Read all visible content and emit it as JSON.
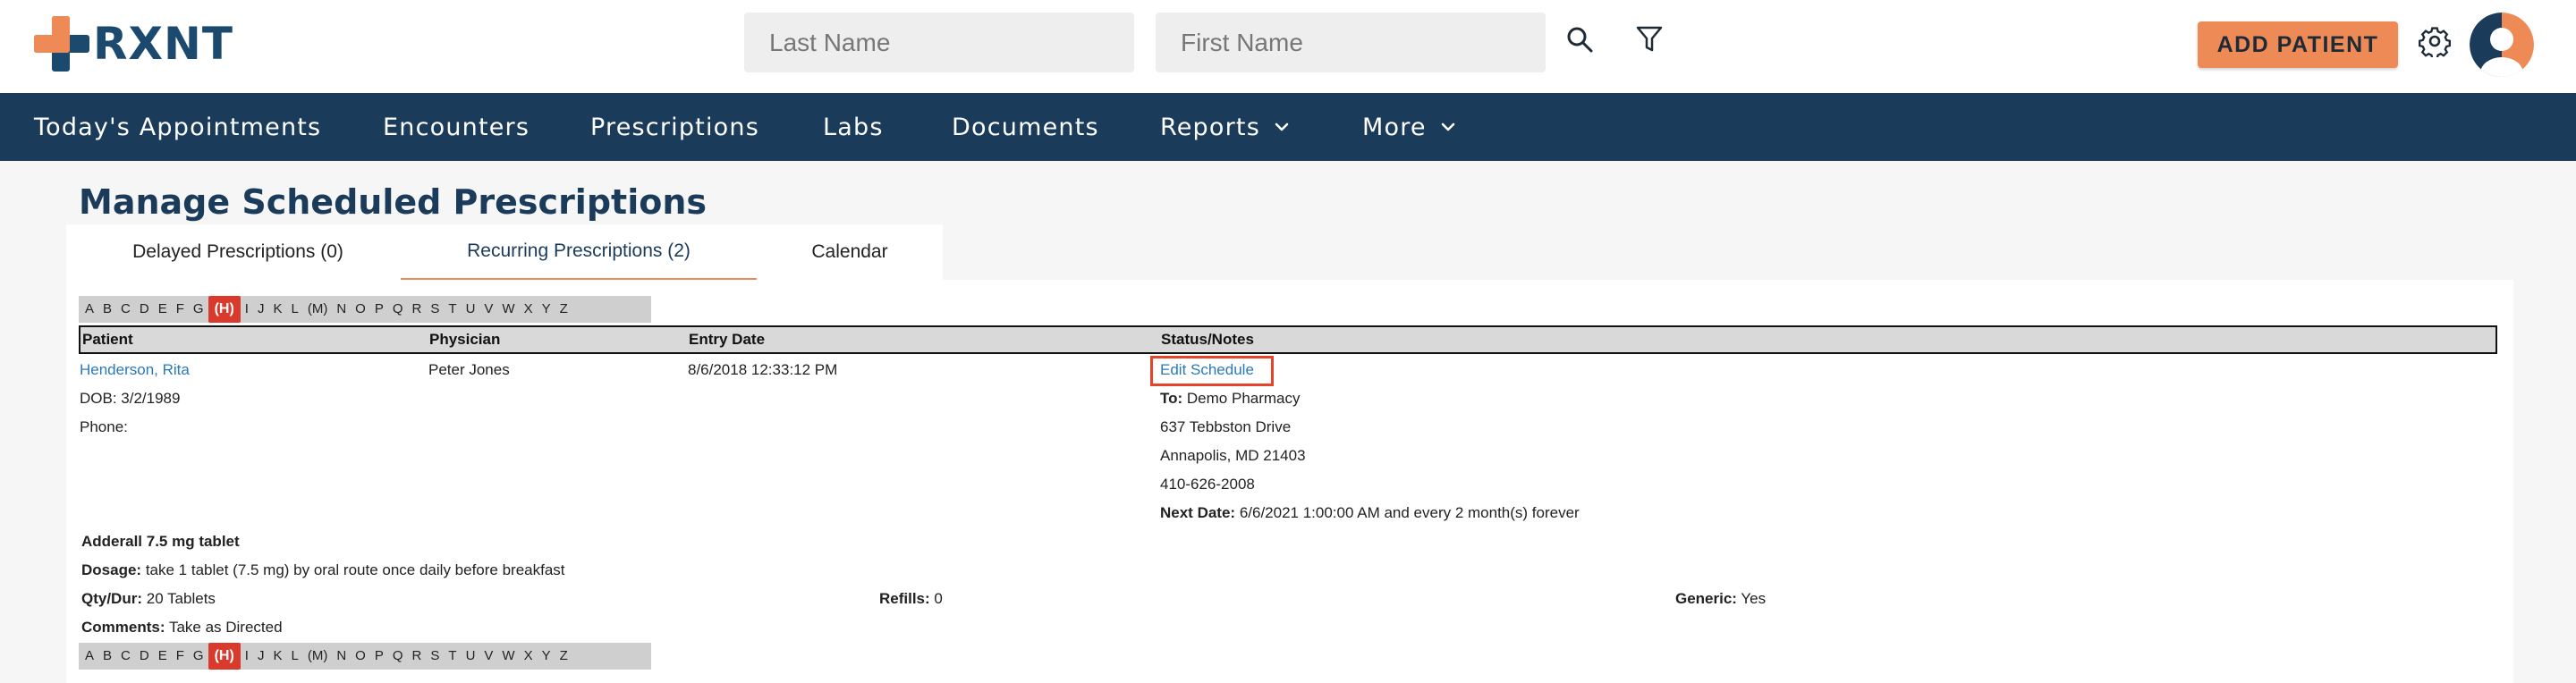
{
  "brand": {
    "logo_text": "RXNT",
    "accent": "#ee8a55",
    "navy": "#1b3b5a",
    "highlight": "#d93a2b"
  },
  "search": {
    "last_name_placeholder": "Last Name",
    "first_name_placeholder": "First Name",
    "search_icon": "search-icon",
    "filter_icon": "filter-icon"
  },
  "header": {
    "add_patient_label": "ADD PATIENT",
    "settings_icon": "gear-icon",
    "avatar_icon": "user-avatar-icon"
  },
  "nav": {
    "items": [
      {
        "label": "Today's Appointments"
      },
      {
        "label": "Encounters"
      },
      {
        "label": "Prescriptions"
      },
      {
        "label": "Labs"
      },
      {
        "label": "Documents"
      },
      {
        "label": "Reports",
        "has_dropdown": true
      },
      {
        "label": "More",
        "has_dropdown": true
      }
    ]
  },
  "page": {
    "title": "Manage Scheduled Prescriptions"
  },
  "tabs": [
    {
      "label": "Delayed Prescriptions (0)",
      "active": false
    },
    {
      "label": "Recurring Prescriptions (2)",
      "active": true
    },
    {
      "label": "Calendar",
      "active": false
    }
  ],
  "alphabet": {
    "letters": [
      "A",
      "B",
      "C",
      "D",
      "E",
      "F",
      "G",
      "(H)",
      "I",
      "J",
      "K",
      "L",
      "(M)",
      "N",
      "O",
      "P",
      "Q",
      "R",
      "S",
      "T",
      "U",
      "V",
      "W",
      "X",
      "Y",
      "Z"
    ],
    "selected": "(H)"
  },
  "table": {
    "columns": {
      "patient": "Patient",
      "physician": "Physician",
      "entry_date": "Entry Date",
      "status": "Status/Notes"
    },
    "row": {
      "patient_name": "Henderson, Rita",
      "dob": "DOB: 3/2/1989",
      "phone": "Phone:",
      "physician": "Peter Jones",
      "entry_date": "8/6/2018 12:33:12 PM",
      "edit_schedule": "Edit Schedule",
      "to_label": "To:",
      "pharmacy": "Demo Pharmacy",
      "address1": "637 Tebbston Drive",
      "address2": "Annapolis, MD 21403",
      "pharmacy_phone": "410-626-2008",
      "next_date_label": "Next Date:",
      "next_date_value": "6/6/2021 1:00:00 AM and every 2 month(s) forever"
    },
    "drug": {
      "name": "Adderall 7.5 mg tablet",
      "dosage_label": "Dosage:",
      "dosage_value": "take 1 tablet (7.5 mg) by oral route once daily before breakfast",
      "qty_label": "Qty/Dur:",
      "qty_value": "20 Tablets",
      "refills_label": "Refills:",
      "refills_value": "0",
      "generic_label": "Generic:",
      "generic_value": "Yes",
      "comments_label": "Comments:",
      "comments_value": "Take as Directed"
    }
  }
}
